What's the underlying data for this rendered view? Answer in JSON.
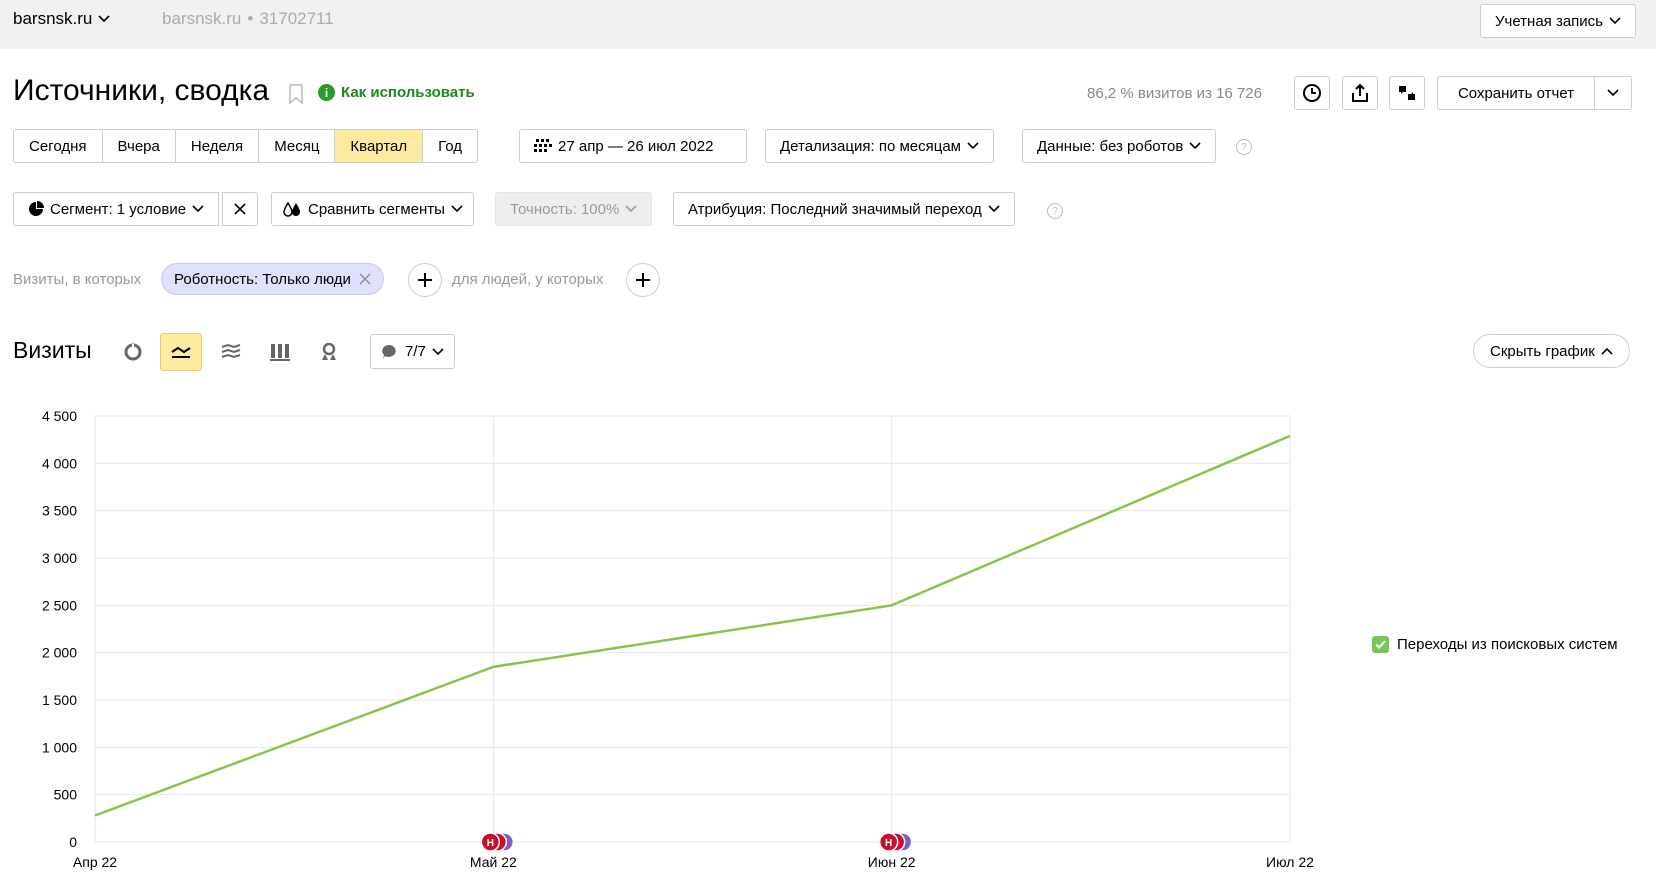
{
  "topbar": {
    "site": "barsnsk.ru",
    "counter_site": "barsnsk.ru",
    "counter_sep": "•",
    "counter_id": "31702711",
    "account": "Учетная запись"
  },
  "header": {
    "title": "Источники, сводка",
    "howto": "Как использовать",
    "visits_note": "86,2 % визитов из 16 726",
    "save_report": "Сохранить отчет"
  },
  "periods": [
    {
      "label": "Сегодня",
      "active": false
    },
    {
      "label": "Вчера",
      "active": false
    },
    {
      "label": "Неделя",
      "active": false
    },
    {
      "label": "Месяц",
      "active": false
    },
    {
      "label": "Квартал",
      "active": true
    },
    {
      "label": "Год",
      "active": false
    }
  ],
  "toolbar": {
    "date_range": "27 апр — 26 июл 2022",
    "detail": "Детализация: по месяцам",
    "data": "Данные: без роботов",
    "segment": "Сегмент: 1 условие",
    "compare": "Сравнить сегменты",
    "accuracy": "Точность: 100%",
    "attribution": "Атрибуция: Последний значимый переход"
  },
  "filters": {
    "visits_label": "Визиты, в которых",
    "chip": "Роботность: Только люди",
    "people_label": "для людей, у которых"
  },
  "chart_section": {
    "title": "Визиты",
    "notes": "7/7",
    "hide": "Скрыть график"
  },
  "colors": {
    "accent_yellow": "#ffeba0",
    "line_green": "#8bc34a",
    "marker_red": "#c8102e",
    "marker_purple": "#7b5fc7"
  },
  "chart_data": {
    "type": "line",
    "x": [
      "Апр 22",
      "Май 22",
      "Июн 22",
      "Июл 22"
    ],
    "series": [
      {
        "name": "Переходы из поисковых систем",
        "values": [
          280,
          1850,
          2500,
          4290
        ]
      }
    ],
    "ylim": [
      0,
      4500
    ],
    "yticks": [
      0,
      500,
      1000,
      1500,
      2000,
      2500,
      3000,
      3500,
      4000,
      4500
    ],
    "ytick_labels": [
      "0",
      "500",
      "1 000",
      "1 500",
      "2 000",
      "2 500",
      "3 000",
      "3 500",
      "4 000",
      "4 500"
    ],
    "grid": true,
    "legend": "right",
    "note_markers": [
      {
        "x": "Май 22",
        "label": "Н"
      },
      {
        "x": "Июн 22",
        "label": "Н"
      }
    ]
  }
}
